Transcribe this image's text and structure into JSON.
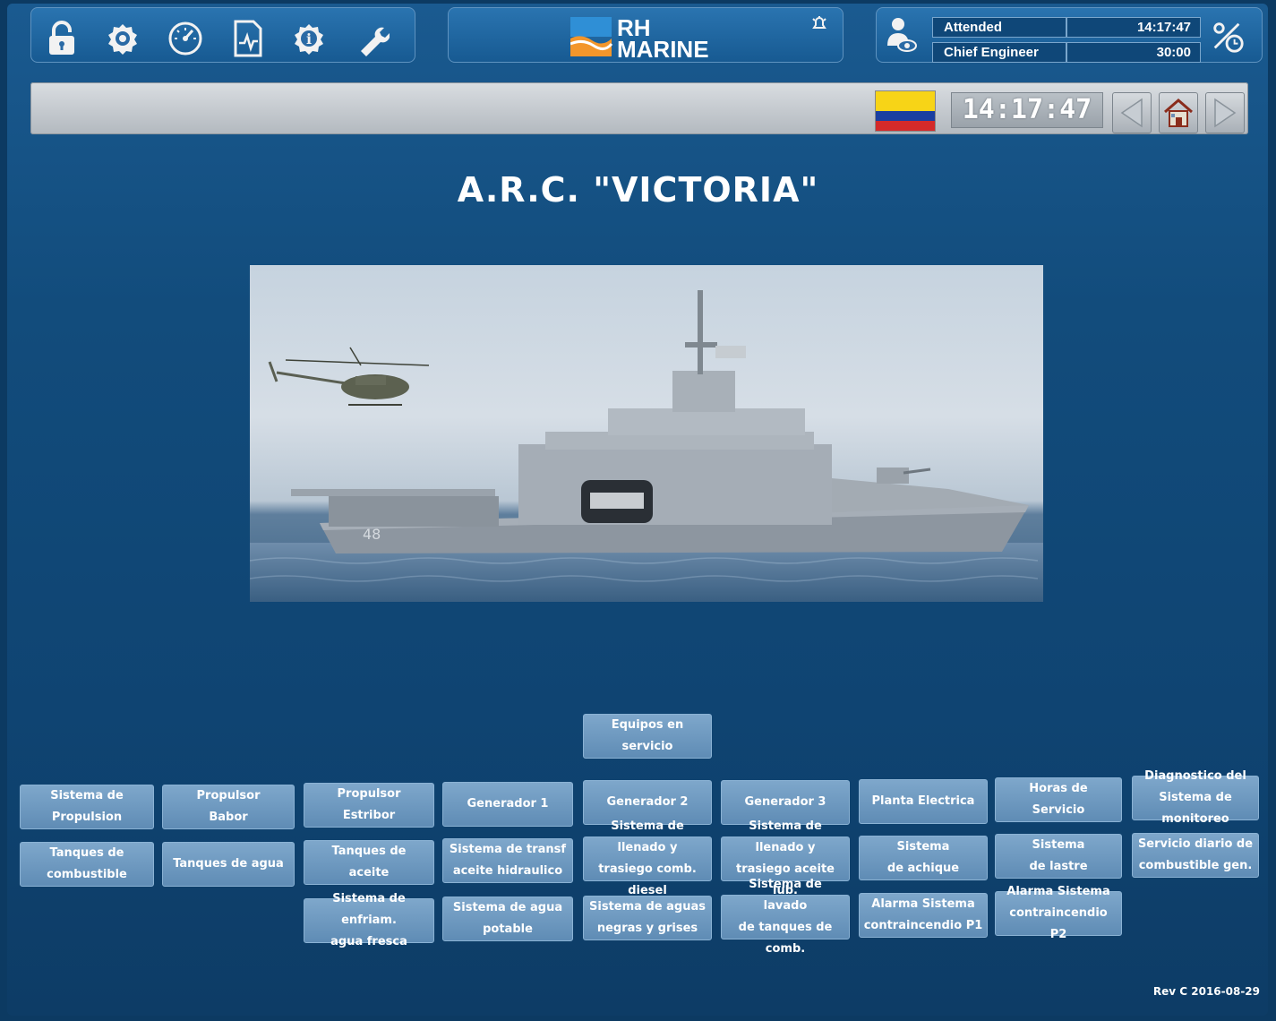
{
  "header": {
    "toolbar_icons": [
      "lock-icon",
      "settings-gear-icon",
      "gauge-icon",
      "trend-document-icon",
      "info-gear-icon",
      "wrench-icon",
      "alarm-bell-icon",
      "user-watch-icon",
      "percent-timer-icon"
    ],
    "logo_line1": "RH",
    "logo_line2": "MARINE",
    "status_label_1": "Attended",
    "status_value_1": "14:17:47",
    "status_label_2": "Chief Engineer",
    "status_value_2": "30:00"
  },
  "navbar": {
    "clock": "14:17:47",
    "flag": "colombia-flag",
    "prev_icon": "arrow-left-icon",
    "home_icon": "home-icon",
    "next_icon": "arrow-right-icon"
  },
  "main": {
    "title": "A.R.C. \"VICTORIA\"",
    "hull_number": "48",
    "featured_button": "Equipos en servicio"
  },
  "grid": {
    "row1": [
      "Sistema de\nPropulsion",
      "Propulsor\nBabor",
      "Propulsor\nEstribor",
      "Generador  1",
      "Generador  2",
      "Generador  3",
      "Planta Electrica",
      "Horas de\nServicio",
      "Diagnostico del\nSistema de monitoreo"
    ],
    "row2": [
      "Tanques de\ncombustible",
      "Tanques de agua",
      "Tanques de\naceite",
      "Sistema de transf\naceite hidraulico",
      "Sistema de llenado y\ntrasiego comb. diesel",
      "Sistema de llenado y\ntrasiego aceite lub.",
      "Sistema\nde achique",
      "Sistema\nde lastre",
      "Servicio diario de\ncombustible gen."
    ],
    "row3": [
      "Sistema de enfriam.\nagua fresca",
      "Sistema de agua\npotable",
      "Sistema de aguas\nnegras y grises",
      "Sistema de lavado\nde tanques de comb.",
      "Alarma Sistema\ncontraincendio P1",
      "Alarma Sistema\ncontraincendio P2"
    ]
  },
  "footer": {
    "revision": "Rev C  2016-08-29"
  },
  "colors": {
    "background": "#124c7c",
    "button": "#6a96be",
    "navbar": "#c5cad0"
  }
}
